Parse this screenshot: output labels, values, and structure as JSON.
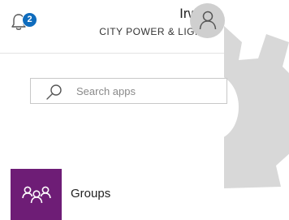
{
  "header": {
    "notification_count": "2",
    "user_name": "Irwin",
    "organization": "CITY POWER & LIGHT",
    "bell_icon": "bell-icon",
    "avatar_icon": "person-icon"
  },
  "search": {
    "placeholder": "Search apps",
    "value": "",
    "icon": "search-icon"
  },
  "apps": [
    {
      "label": "Groups",
      "icon": "groups-icon",
      "tile_color": "#6e1d76"
    }
  ],
  "decor": {
    "gear_icon": "gear-icon",
    "gear_color": "#d6d6d6"
  },
  "colors": {
    "badge": "#0f6cbd",
    "avatar_bg": "#cfcfcf"
  }
}
